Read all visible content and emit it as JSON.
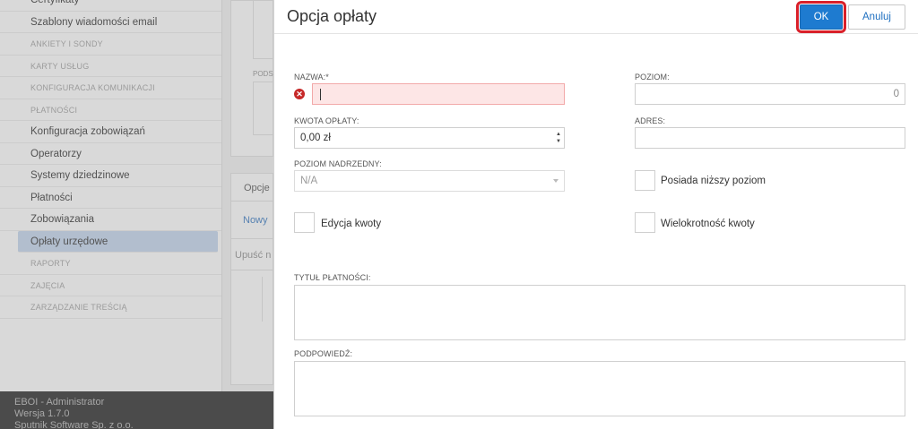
{
  "sidebar": {
    "items": [
      {
        "label": "Certyfikaty",
        "kind": "item"
      },
      {
        "label": "Szablony wiadomości email",
        "kind": "item"
      },
      {
        "label": "ANKIETY I SONDY",
        "kind": "section"
      },
      {
        "label": "KARTY USŁUG",
        "kind": "section"
      },
      {
        "label": "KONFIGURACJA KOMUNIKACJI",
        "kind": "section"
      },
      {
        "label": "PŁATNOŚCI",
        "kind": "section"
      },
      {
        "label": "Konfiguracja zobowiązań",
        "kind": "item"
      },
      {
        "label": "Operatorzy",
        "kind": "item"
      },
      {
        "label": "Systemy dziedzinowe",
        "kind": "item"
      },
      {
        "label": "Płatności",
        "kind": "item"
      },
      {
        "label": "Zobowiązania",
        "kind": "item"
      },
      {
        "label": "Opłaty urzędowe",
        "kind": "active"
      },
      {
        "label": "RAPORTY",
        "kind": "section"
      },
      {
        "label": "ZAJĘCIA",
        "kind": "section"
      },
      {
        "label": "ZARZĄDZANIE TREŚCIĄ",
        "kind": "section"
      }
    ]
  },
  "background": {
    "pods_label": "PODS",
    "tab_label": "Opcje",
    "new_link": "Nowy",
    "drop_text": "Upuść n"
  },
  "footer": {
    "line1": "EBOI - Administrator",
    "line2": "Wersja 1.7.0",
    "line3": "Sputnik Software Sp. z o.o."
  },
  "dialog": {
    "title": "Opcja opłaty",
    "ok_label": "OK",
    "cancel_label": "Anuluj",
    "fields": {
      "nazwa_label": "NAZWA:*",
      "nazwa_value": "",
      "kwota_label": "KWOTA OPŁATY:",
      "kwota_value": "0,00 zł",
      "poziom_nadrzedny_label": "POZIOM NADRZEDNY:",
      "poziom_nadrzedny_value": "N/A",
      "edycja_kwoty_label": "Edycja kwoty",
      "poziom_label": "POZIOM:",
      "poziom_value": "0",
      "adres_label": "ADRES:",
      "adres_value": "",
      "posiada_nizszy_label": "Posiada niższy poziom",
      "wielokrotnosc_label": "Wielokrotność kwoty",
      "tytul_label": "TYTUŁ PŁATNOŚCI:",
      "podpowiedz_label": "PODPOWIEDŹ:"
    }
  },
  "colors": {
    "accent": "#1e7bd0",
    "highlight": "#d9202a",
    "error_bg": "#fde6e6",
    "active_item": "#c9daf0"
  }
}
